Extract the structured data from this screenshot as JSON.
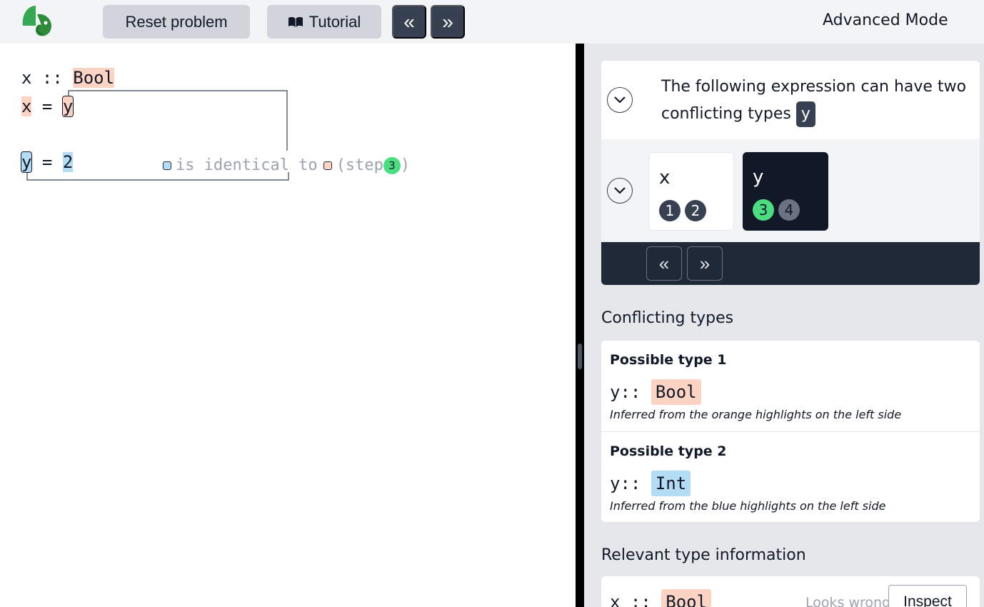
{
  "toolbar": {
    "reset_label": "Reset problem",
    "tutorial_label": "Tutorial",
    "prev_symbol": "«",
    "next_symbol": "»",
    "mode_label": "Advanced Mode"
  },
  "editor": {
    "line1": {
      "var": "x",
      "op": " :: ",
      "type": "Bool"
    },
    "line2": {
      "var": "x",
      "op": " = ",
      "val": "y"
    },
    "line3": {
      "var": "y",
      "op": " = ",
      "val": "2"
    },
    "annotation": {
      "text": "is identical to",
      "step_prefix": "(step",
      "step_num": "3",
      "step_suffix": ")"
    }
  },
  "panel": {
    "conflict_message": "The following expression can have two conflicting types",
    "conflict_expr": "y",
    "vars": [
      {
        "name": "x",
        "steps": [
          "1",
          "2"
        ]
      },
      {
        "name": "y",
        "steps": [
          "3",
          "4"
        ]
      }
    ],
    "nav": {
      "prev_symbol": "«",
      "next_symbol": "»"
    },
    "conflicting_title": "Conflicting types",
    "possible_types": [
      {
        "title": "Possible type 1",
        "var": "y",
        "sep": ":: ",
        "type": "Bool",
        "note": "Inferred from the orange highlights on the left side"
      },
      {
        "title": "Possible type 2",
        "var": "y",
        "sep": ":: ",
        "type": "Int",
        "note": "Inferred from the blue highlights on the left side"
      }
    ],
    "relevant_title": "Relevant type information",
    "relevant_row": {
      "var": "x",
      "sep": " :: ",
      "type": "Bool",
      "looks_wrong": "Looks wrong?",
      "inspect_label": "Inspect"
    }
  },
  "colors": {
    "orange_highlight": "#fdd4c4",
    "blue_highlight": "#b3dcf5",
    "step_active": "#4ade80",
    "dark": "#374151"
  },
  "icons": {
    "logo": "chameleon-logo-icon",
    "tutorial": "book-icon",
    "chevron": "chevron-down-icon"
  }
}
